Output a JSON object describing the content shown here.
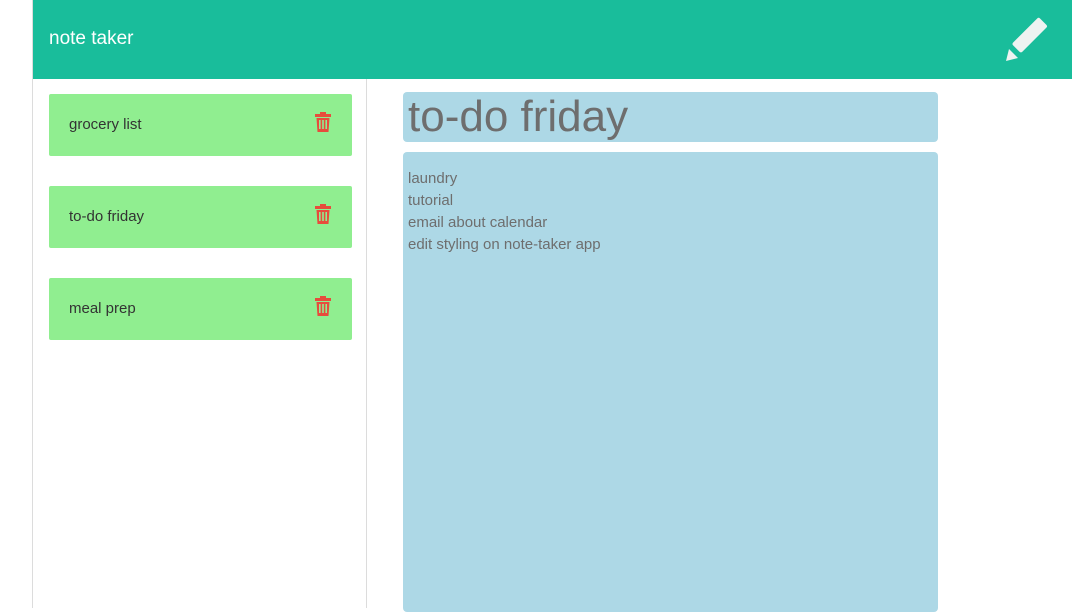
{
  "navbar": {
    "brand": "note taker",
    "new_note_icon": "pencil-icon",
    "background_color": "#19bd9b"
  },
  "sidebar": {
    "items": [
      {
        "label": "grocery list",
        "icon": "trash-icon"
      },
      {
        "label": "to-do friday",
        "icon": "trash-icon"
      },
      {
        "label": "meal prep",
        "icon": "trash-icon"
      }
    ],
    "item_color": "#90ee90",
    "delete_icon_color": "#e74c3c"
  },
  "editor": {
    "title": "to-do friday",
    "body": "laundry\ntutorial\nemail about calendar\nedit styling on note-taker app",
    "background_color": "#add8e6"
  }
}
